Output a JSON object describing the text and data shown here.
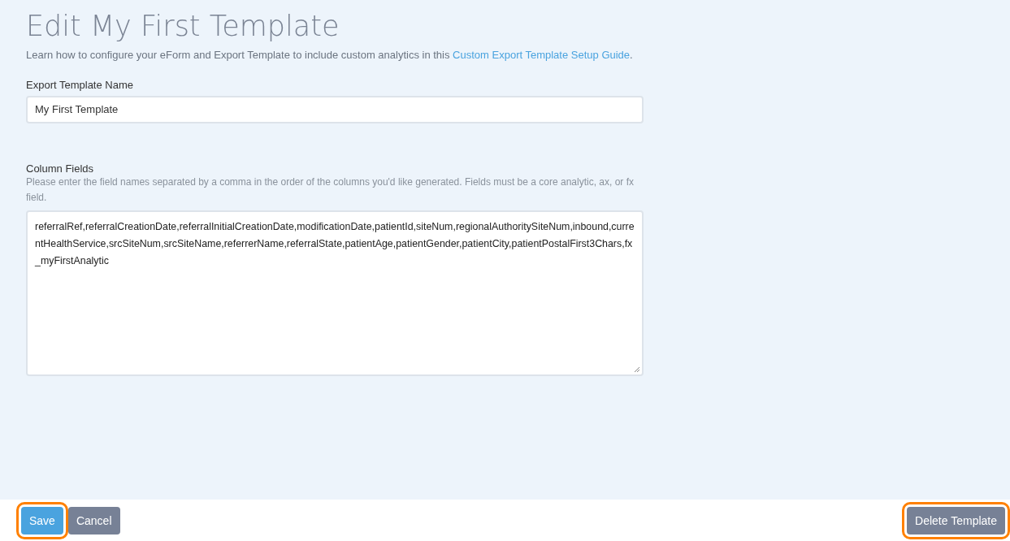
{
  "title": "Edit My First Template",
  "intro": {
    "text": "Learn how to configure your eForm and Export Template to include custom analytics in this ",
    "link": "Custom Export Template Setup Guide",
    "after": "."
  },
  "name_field": {
    "label": "Export Template Name",
    "value": "My First Template"
  },
  "columns_field": {
    "label": "Column Fields",
    "help": "Please enter the field names separated by a comma in the order of the columns you'd like generated. Fields must be a core analytic, ax, or fx field.",
    "value": "referralRef,referralCreationDate,referralInitialCreationDate,modificationDate,patientId,siteNum,regionalAuthoritySiteNum,inbound,currentHealthService,srcSiteNum,srcSiteName,referrerName,referralState,patientAge,patientGender,patientCity,patientPostalFirst3Chars,fx_myFirstAnalytic"
  },
  "footer": {
    "left_buttons": [
      {
        "label": "Save",
        "kind": "primary",
        "highlighted": true
      },
      {
        "label": "Cancel",
        "kind": "secondary",
        "highlighted": false
      }
    ],
    "right_buttons": [
      {
        "label": "Delete Template",
        "kind": "secondary",
        "highlighted": true
      }
    ]
  }
}
